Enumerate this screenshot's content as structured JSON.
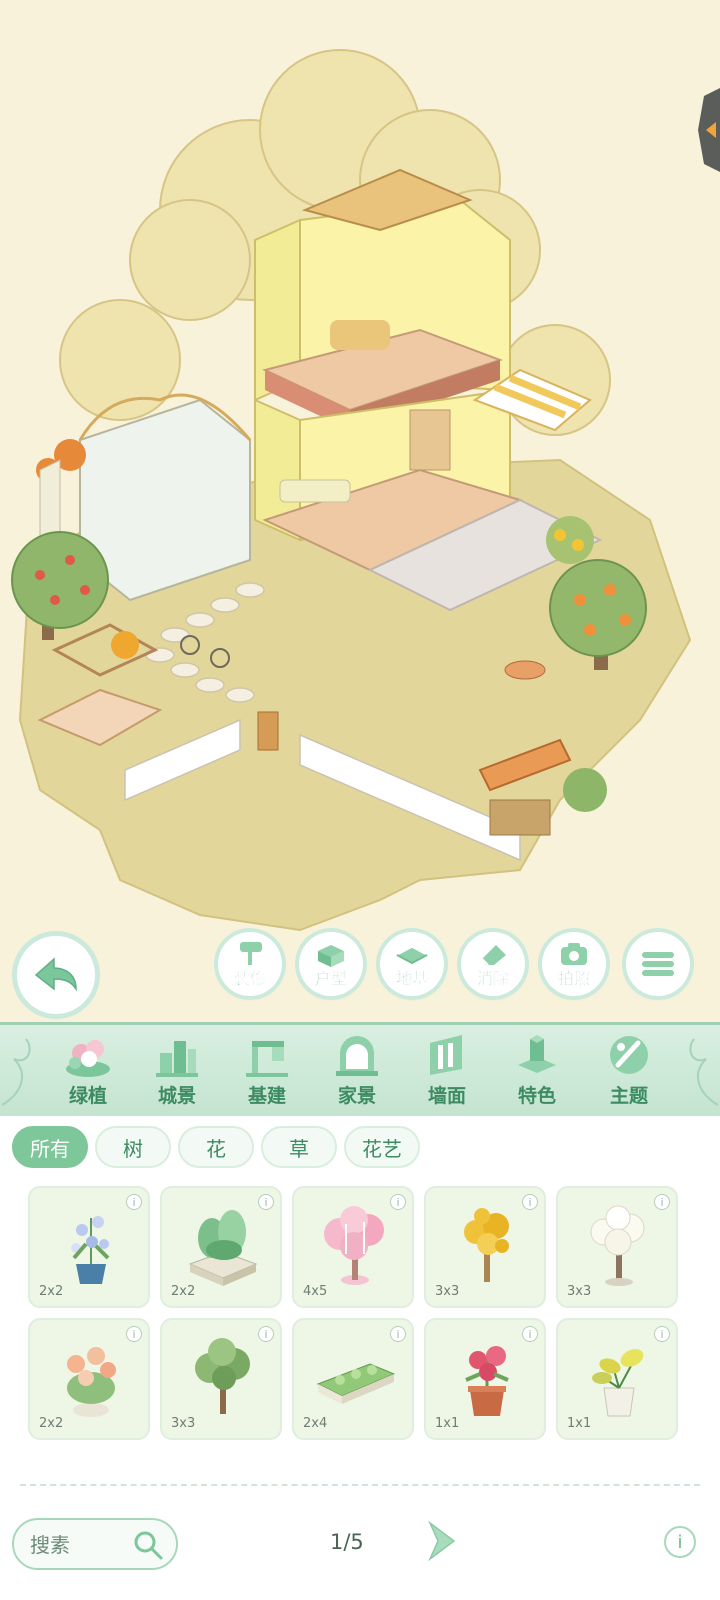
{
  "toolbar": {
    "back_icon": "back-arrow-icon",
    "buttons": [
      {
        "label": "装修",
        "icon": "roller-icon"
      },
      {
        "label": "户型",
        "icon": "floorplan-icon"
      },
      {
        "label": "地基",
        "icon": "foundation-icon"
      },
      {
        "label": "消除",
        "icon": "eraser-icon"
      },
      {
        "label": "拍照",
        "icon": "camera-icon"
      }
    ],
    "menu_icon": "hamburger-icon"
  },
  "categories": [
    {
      "label": "绿植",
      "icon": "plant-icon",
      "active": true
    },
    {
      "label": "城景",
      "icon": "city-icon"
    },
    {
      "label": "基建",
      "icon": "build-icon"
    },
    {
      "label": "家景",
      "icon": "home-icon"
    },
    {
      "label": "墙面",
      "icon": "wall-icon"
    },
    {
      "label": "特色",
      "icon": "special-icon"
    },
    {
      "label": "主题",
      "icon": "theme-icon"
    }
  ],
  "filters": [
    {
      "label": "所有",
      "active": true
    },
    {
      "label": "树"
    },
    {
      "label": "花"
    },
    {
      "label": "草"
    },
    {
      "label": "花艺"
    }
  ],
  "items": [
    {
      "size": "2x2",
      "icon": "blue-flower-pot-icon"
    },
    {
      "size": "2x2",
      "icon": "leafy-planter-icon"
    },
    {
      "size": "4x5",
      "icon": "pink-blossom-tree-icon"
    },
    {
      "size": "3x3",
      "icon": "yellow-tree-icon"
    },
    {
      "size": "3x3",
      "icon": "white-blossom-tree-icon"
    },
    {
      "size": "2x2",
      "icon": "peach-rose-bush-icon"
    },
    {
      "size": "3x3",
      "icon": "green-tree-icon"
    },
    {
      "size": "2x4",
      "icon": "hedge-planter-icon"
    },
    {
      "size": "1x1",
      "icon": "protea-pot-icon"
    },
    {
      "size": "1x1",
      "icon": "yellow-leaf-pot-icon"
    }
  ],
  "info_glyph": "i",
  "search": {
    "placeholder": "搜素"
  },
  "pagination": {
    "text": "1/5"
  },
  "colors": {
    "accent": "#7dc79a",
    "text": "#3d8b62",
    "background": "#f8f2da"
  }
}
